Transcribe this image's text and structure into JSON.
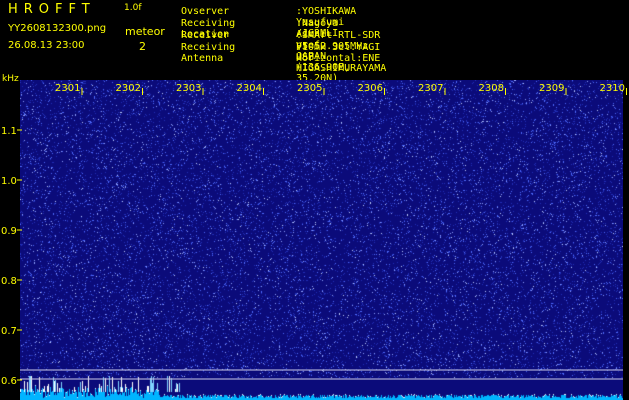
{
  "header": {
    "app_title": "HROFFT",
    "app_version": "1.0f",
    "filename": "YY2608132300.png",
    "datetime": "26.08.13 23:00",
    "meteor_label": "meteor",
    "meteor_count": "2"
  },
  "info": [
    {
      "key": "Ovserver",
      "value": ":YOSHIKAWA Yasufumi /JG2MLI"
    },
    {
      "key": "Receiving Location",
      "value": ":Nagoya Aichi-pref. JAPAN (136.90E, 35.20N)"
    },
    {
      "key": "Receiver",
      "value": ":SMArt RTL-SDR V5 52.905MHz USB HIGASHIMURAYAMA"
    },
    {
      "key": "Receiving Antenna",
      "value": ":10mH 3el.YAGI Horizontal:ENE"
    }
  ],
  "axis": {
    "y_unit": "kHz",
    "time_labels": [
      "2301",
      "2302",
      "2303",
      "2304",
      "2305",
      "2306",
      "2307",
      "2308",
      "2309",
      "2310"
    ],
    "freq_labels": [
      "1.1",
      "1.0",
      "0.9",
      "0.8",
      "0.7",
      "0.6"
    ]
  },
  "colors": {
    "background": "#000000",
    "text": "#ffff00",
    "spectrogram_base": "#0b0b7a",
    "noise_dot": "#4f6bff",
    "bright_dot": "#c0d0ff",
    "baseline": "#00b4ff"
  }
}
